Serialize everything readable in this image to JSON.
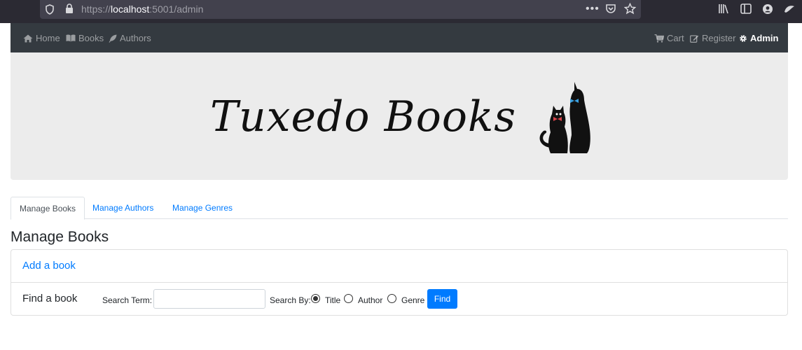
{
  "browser": {
    "url_prefix": "https://",
    "url_host": "localhost",
    "url_rest": ":5001/admin"
  },
  "navbar": {
    "left": [
      {
        "label": "Home",
        "icon": "home-icon"
      },
      {
        "label": "Books",
        "icon": "book-icon"
      },
      {
        "label": "Authors",
        "icon": "feather-icon"
      }
    ],
    "right": [
      {
        "label": "Cart",
        "icon": "cart-icon"
      },
      {
        "label": "Register",
        "icon": "edit-icon"
      },
      {
        "label": "Admin",
        "icon": "gear-icon",
        "active": true
      }
    ]
  },
  "banner": {
    "logo_text": "Tuxedo Books"
  },
  "tabs": [
    {
      "label": "Manage Books",
      "active": true
    },
    {
      "label": "Manage Authors",
      "active": false
    },
    {
      "label": "Manage Genres",
      "active": false
    }
  ],
  "page_title": "Manage Books",
  "card": {
    "add_link": "Add a book",
    "find_label": "Find a book",
    "search_term_label": "Search Term:",
    "search_term_value": "",
    "search_by_label": "Search By:",
    "search_by_options": [
      {
        "label": "Title",
        "checked": true
      },
      {
        "label": "Author",
        "checked": false
      },
      {
        "label": "Genre",
        "checked": false
      }
    ],
    "find_button": "Find"
  },
  "colors": {
    "navbar_bg": "#343a40",
    "link": "#007bff",
    "banner_bg": "#ececec",
    "primary_button": "#007bff"
  }
}
